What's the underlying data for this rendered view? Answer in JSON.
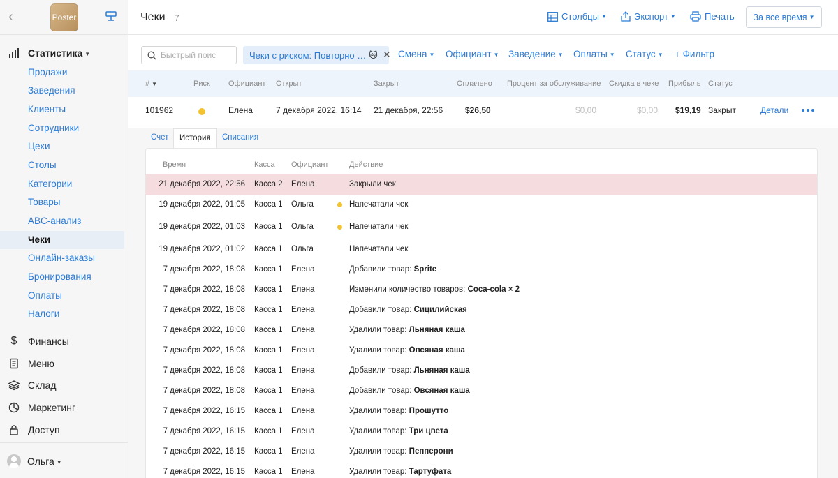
{
  "sidebar": {
    "logo_text": "Poster",
    "sections_top": {
      "label": "Статистика"
    },
    "items": [
      {
        "label": "Продажи"
      },
      {
        "label": "Заведения"
      },
      {
        "label": "Клиенты"
      },
      {
        "label": "Сотрудники"
      },
      {
        "label": "Цехи"
      },
      {
        "label": "Столы"
      },
      {
        "label": "Категории"
      },
      {
        "label": "Товары"
      },
      {
        "label": "ABC-анализ"
      },
      {
        "label": "Чеки"
      },
      {
        "label": "Онлайн-заказы"
      },
      {
        "label": "Бронирования"
      },
      {
        "label": "Оплаты"
      },
      {
        "label": "Налоги"
      }
    ],
    "sections": [
      {
        "label": "Финансы"
      },
      {
        "label": "Меню"
      },
      {
        "label": "Склад"
      },
      {
        "label": "Маркетинг"
      },
      {
        "label": "Доступ"
      }
    ],
    "user": "Ольга"
  },
  "header": {
    "title": "Чеки",
    "count": "7",
    "columns_label": "Столбцы",
    "export_label": "Экспорт",
    "print_label": "Печать",
    "range_label": "За все время"
  },
  "filters": {
    "search_placeholder": "Быстрый поис",
    "chip_label": "Чеки с риском: Повторно …",
    "chip_emoji": "🙀",
    "items": [
      "Смена",
      "Официант",
      "Заведение",
      "Оплаты",
      "Статус"
    ],
    "add_filter": "+ Фильтр"
  },
  "table": {
    "columns": [
      "#",
      "Риск",
      "Официант",
      "Открыт",
      "Закрыт",
      "Оплачено",
      "Процент за обслуживание",
      "Скидка в чеке",
      "Прибыль",
      "Статус"
    ],
    "row": {
      "id": "101962",
      "waiter": "Елена",
      "opened": "7 декабря 2022, 16:14",
      "closed": "21 декабря, 22:56",
      "paid": "$26,50",
      "service": "$0,00",
      "discount": "$0,00",
      "profit": "$19,19",
      "status": "Закрыт",
      "details": "Детали"
    }
  },
  "subtabs": [
    "Счет",
    "История",
    "Списания"
  ],
  "history": {
    "columns": [
      "Время",
      "Касса",
      "Официант",
      "Действие"
    ],
    "rows": [
      {
        "time": "21 декабря 2022, 22:56",
        "till": "Касса 2",
        "waiter": "Елена",
        "action": "Закрыли чек",
        "item": ""
      },
      {
        "time": "19 декабря 2022, 01:05",
        "till": "Касса 1",
        "waiter": "Ольга",
        "action": "Напечатали чек",
        "item": ""
      },
      {
        "time": "19 декабря 2022, 01:03",
        "till": "Касса 1",
        "waiter": "Ольга",
        "action": "Напечатали чек",
        "item": ""
      },
      {
        "time": "19 декабря 2022, 01:02",
        "till": "Касса 1",
        "waiter": "Ольга",
        "action": "Напечатали чек",
        "item": ""
      },
      {
        "time": "7 декабря 2022, 18:08",
        "till": "Касса 1",
        "waiter": "Елена",
        "action": "Добавили товар: ",
        "item": "Sprite"
      },
      {
        "time": "7 декабря 2022, 18:08",
        "till": "Касса 1",
        "waiter": "Елена",
        "action": "Изменили количество товаров: ",
        "item": "Coca-cola × 2"
      },
      {
        "time": "7 декабря 2022, 18:08",
        "till": "Касса 1",
        "waiter": "Елена",
        "action": "Добавили товар: ",
        "item": "Сицилийская"
      },
      {
        "time": "7 декабря 2022, 18:08",
        "till": "Касса 1",
        "waiter": "Елена",
        "action": "Удалили товар: ",
        "item": "Льняная каша"
      },
      {
        "time": "7 декабря 2022, 18:08",
        "till": "Касса 1",
        "waiter": "Елена",
        "action": "Удалили товар: ",
        "item": "Овсяная каша"
      },
      {
        "time": "7 декабря 2022, 18:08",
        "till": "Касса 1",
        "waiter": "Елена",
        "action": "Добавили товар: ",
        "item": "Льняная каша"
      },
      {
        "time": "7 декабря 2022, 18:08",
        "till": "Касса 1",
        "waiter": "Елена",
        "action": "Добавили товар: ",
        "item": "Овсяная каша"
      },
      {
        "time": "7 декабря 2022, 16:15",
        "till": "Касса 1",
        "waiter": "Елена",
        "action": "Удалили товар: ",
        "item": "Прошутто"
      },
      {
        "time": "7 декабря 2022, 16:15",
        "till": "Касса 1",
        "waiter": "Елена",
        "action": "Удалили товар: ",
        "item": "Три цвета"
      },
      {
        "time": "7 декабря 2022, 16:15",
        "till": "Касса 1",
        "waiter": "Елена",
        "action": "Удалили товар: ",
        "item": "Пепперони"
      },
      {
        "time": "7 декабря 2022, 16:15",
        "till": "Касса 1",
        "waiter": "Елена",
        "action": "Удалили товар: ",
        "item": "Тартуфата"
      }
    ]
  }
}
